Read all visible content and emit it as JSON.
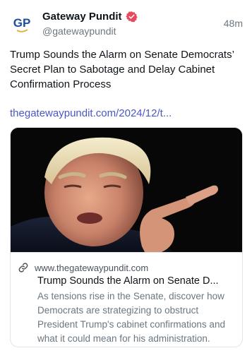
{
  "author": {
    "avatar_text": "GP",
    "display_name": "Gateway Pundit",
    "handle": "@gatewaypundit",
    "verified_icon": "verified-badge-icon"
  },
  "post": {
    "time": "48m",
    "text": "Trump Sounds the Alarm on Senate Democrats’ Secret Plan to Sabotage and Delay Cabinet Confirmation Process",
    "link": "thegatewaypundit.com/2024/12/t..."
  },
  "link_card": {
    "domain": "www.thegatewaypundit.com",
    "title": "Trump Sounds the Alarm on Senate D...",
    "description": "As tensions rise in the Senate, discover how Democrats are strategizing to obstruct President Trump's cabinet confirmations and what it could mean for his administration.",
    "link_icon": "link-icon",
    "image_icon": "photo-thumbnail"
  },
  "colors": {
    "text_primary": "#0f1419",
    "text_secondary": "#6b7780",
    "link": "#4a57c8",
    "avatar_brand": "#1b4fa0",
    "verified": "#e8495d",
    "border": "#e1e4e8"
  }
}
